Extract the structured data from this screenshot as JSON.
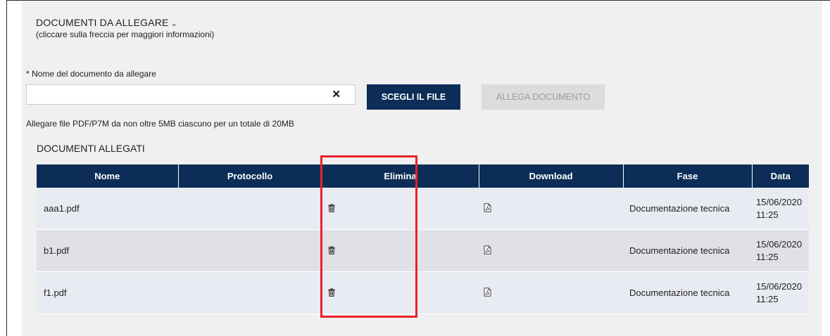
{
  "section": {
    "title": "DOCUMENTI DA ALLEGARE",
    "chevron": "⌄",
    "hint": "(cliccare sulla freccia per maggiori informazioni)"
  },
  "form": {
    "label": "* Nome del documento da allegare",
    "input_value": "",
    "clear_symbol": "✕",
    "choose_button": "SCEGLI IL FILE",
    "attach_button": "ALLEGA DOCUMENTO",
    "limit_note": "Allegare file PDF/P7M da non oltre 5MB ciascuno per un totale di 20MB"
  },
  "attached": {
    "title": "DOCUMENTI ALLEGATI",
    "columns": [
      "Nome",
      "Protocollo",
      "Elimina",
      "Download",
      "Fase",
      "Data"
    ],
    "rows": [
      {
        "nome": "aaa1.pdf",
        "protocollo": "",
        "fase": "Documentazione tecnica",
        "date": "15/06/2020",
        "time": "11:25"
      },
      {
        "nome": "b1.pdf",
        "protocollo": "",
        "fase": "Documentazione tecnica",
        "date": "15/06/2020",
        "time": "11:25"
      },
      {
        "nome": "f1.pdf",
        "protocollo": "",
        "fase": "Documentazione tecnica",
        "date": "15/06/2020",
        "time": "11:25"
      }
    ]
  },
  "icons": {
    "delete": "trash-icon",
    "download": "pdf-file-icon"
  },
  "colors": {
    "primary": "#0c2d57",
    "highlight": "#e8232b",
    "disabled_bg": "#dcdcdc"
  }
}
